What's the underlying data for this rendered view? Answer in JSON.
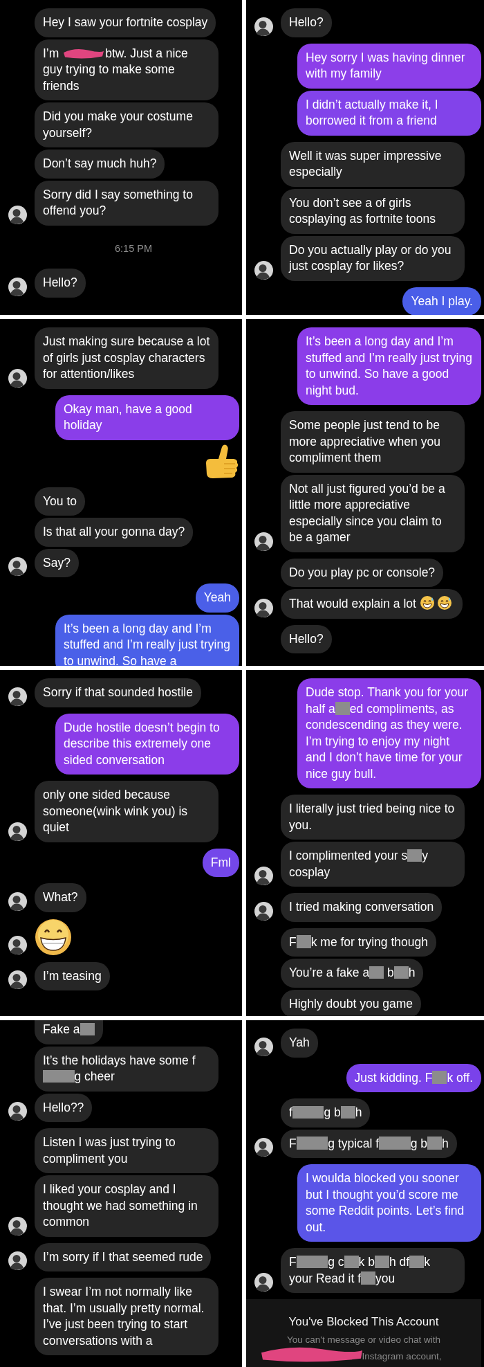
{
  "panels": [
    {
      "items": [
        {
          "kind": "group",
          "outgoing": false,
          "avatar": true,
          "messages": [
            {
              "kind": "text",
              "text": "Hey I saw your fortnite cosplay"
            },
            {
              "kind": "parts",
              "parts": [
                {
                  "kind": "text",
                  "text": "I’m "
                },
                {
                  "kind": "scribble"
                },
                {
                  "kind": "text",
                  "text": "btw. Just a nice"
                },
                {
                  "kind": "block",
                  "text": "guy trying to make some friends"
                }
              ]
            },
            {
              "kind": "text",
              "text": "Did you make your costume yourself?"
            },
            {
              "kind": "text",
              "text": "Don’t say much huh?"
            },
            {
              "kind": "text",
              "text": "Sorry did I say something to offend you?"
            }
          ]
        },
        {
          "kind": "time",
          "text": "6:15 PM"
        },
        {
          "kind": "group",
          "outgoing": false,
          "avatar": true,
          "messages": [
            {
              "kind": "text",
              "text": "Hello?"
            }
          ]
        }
      ]
    },
    {
      "items": [
        {
          "kind": "group",
          "outgoing": false,
          "avatar": true,
          "messages": [
            {
              "kind": "text",
              "text": "Hello?"
            }
          ]
        },
        {
          "kind": "group",
          "outgoing": true,
          "messages": [
            {
              "kind": "text",
              "text": "Hey sorry I was having dinner with my family",
              "color": "#8c3fe9"
            },
            {
              "kind": "text",
              "text": "I didn’t actually make it, I borrowed it from a friend",
              "color": "#8243ea"
            }
          ]
        },
        {
          "kind": "group",
          "outgoing": false,
          "avatar": true,
          "messages": [
            {
              "kind": "text",
              "text": "Well it was super impressive especially"
            },
            {
              "kind": "text",
              "text": "You don’t see a of girls cosplaying as fortnite toons"
            },
            {
              "kind": "text",
              "text": "Do you actually play or do you just cosplay for likes?"
            }
          ]
        },
        {
          "kind": "group",
          "outgoing": true,
          "messages": [
            {
              "kind": "text",
              "text": "Yeah I play.",
              "color": "#4a5ee8"
            }
          ]
        }
      ]
    },
    {
      "items": [
        {
          "kind": "group",
          "outgoing": false,
          "avatar": true,
          "messages": [
            {
              "kind": "text",
              "text": "Just making sure because a lot of girls just cosplay characters for attention/likes"
            }
          ]
        },
        {
          "kind": "group",
          "outgoing": true,
          "messages": [
            {
              "kind": "text",
              "text": "Okay man, have a good holiday",
              "color": "#8a3ee9"
            },
            {
              "kind": "thumbs"
            }
          ]
        },
        {
          "kind": "group",
          "outgoing": false,
          "avatar": true,
          "messages": [
            {
              "kind": "text",
              "text": "You to"
            },
            {
              "kind": "text",
              "text": "Is that all your gonna day?"
            },
            {
              "kind": "text",
              "text": "Say?"
            }
          ]
        },
        {
          "kind": "group",
          "outgoing": true,
          "messages": [
            {
              "kind": "text",
              "text": "Yeah",
              "color": "#4b5fe8"
            },
            {
              "kind": "text",
              "text": "It’s been a long day and I’m stuffed and I’m really just trying to unwind. So have a",
              "color": "#4a60e8"
            }
          ]
        }
      ]
    },
    {
      "items": [
        {
          "kind": "group",
          "outgoing": true,
          "messages": [
            {
              "kind": "text",
              "text": "It’s been a long day and I’m stuffed and I’m really just trying to unwind. So have a good night bud.",
              "color": "#8b3de9"
            }
          ]
        },
        {
          "kind": "group",
          "outgoing": false,
          "avatar": true,
          "messages": [
            {
              "kind": "text",
              "text": "Some people just tend to be more appreciative when you compliment them"
            },
            {
              "kind": "text",
              "text": "Not all just figured you’d be a little more appreciative especially since you claim to be a gamer"
            }
          ]
        },
        {
          "kind": "group",
          "outgoing": false,
          "avatar": true,
          "messages": [
            {
              "kind": "text",
              "text": "Do you play pc or console?"
            },
            {
              "kind": "parts",
              "parts": [
                {
                  "kind": "text",
                  "text": "That would explain a lot "
                },
                {
                  "kind": "emoji"
                },
                {
                  "kind": "emoji"
                }
              ]
            }
          ]
        },
        {
          "kind": "group",
          "outgoing": false,
          "avatar": false,
          "messages": [
            {
              "kind": "text",
              "text": "Hello?"
            }
          ]
        }
      ]
    },
    {
      "items": [
        {
          "kind": "group",
          "outgoing": false,
          "avatar": true,
          "messages": [
            {
              "kind": "text",
              "text": "Sorry if that sounded hostile"
            }
          ]
        },
        {
          "kind": "group",
          "outgoing": true,
          "messages": [
            {
              "kind": "text",
              "text": "Dude hostile doesn’t begin to describe this extremely one sided conversation",
              "color": "#8b3de9"
            }
          ]
        },
        {
          "kind": "group",
          "outgoing": false,
          "avatar": true,
          "messages": [
            {
              "kind": "text",
              "text": "only one sided because someone(wink wink you) is quiet"
            }
          ]
        },
        {
          "kind": "group",
          "outgoing": true,
          "messages": [
            {
              "kind": "text",
              "text": "Fml",
              "color": "#7447ea"
            }
          ]
        },
        {
          "kind": "group",
          "outgoing": false,
          "avatar": true,
          "messages": [
            {
              "kind": "text",
              "text": "What?"
            }
          ]
        },
        {
          "kind": "group",
          "outgoing": false,
          "avatar": true,
          "messages": [
            {
              "kind": "grin"
            }
          ]
        },
        {
          "kind": "group",
          "outgoing": false,
          "avatar": true,
          "messages": [
            {
              "kind": "text",
              "text": "I’m teasing"
            }
          ]
        }
      ]
    },
    {
      "items": [
        {
          "kind": "group",
          "outgoing": true,
          "messages": [
            {
              "kind": "parts",
              "color": "#8b3de9",
              "parts": [
                {
                  "kind": "text",
                  "text": "Dude stop. Thank you for your half a"
                },
                {
                  "kind": "censor"
                },
                {
                  "kind": "text",
                  "text": "ed compliments, as condescending as they were. I’m trying to enjoy my night and I don’t have time for your nice guy bull."
                }
              ]
            }
          ]
        },
        {
          "kind": "group",
          "outgoing": false,
          "avatar": true,
          "messages": [
            {
              "kind": "text",
              "text": "I literally just tried being nice to you."
            },
            {
              "kind": "parts",
              "parts": [
                {
                  "kind": "text",
                  "text": "I complimented your s"
                },
                {
                  "kind": "censor"
                },
                {
                  "kind": "text",
                  "text": "y cosplay"
                }
              ]
            }
          ]
        },
        {
          "kind": "group",
          "outgoing": false,
          "avatar": true,
          "messages": [
            {
              "kind": "text",
              "text": "I tried making conversation"
            }
          ]
        },
        {
          "kind": "group",
          "outgoing": false,
          "avatar": false,
          "messages": [
            {
              "kind": "parts",
              "parts": [
                {
                  "kind": "text",
                  "text": "F"
                },
                {
                  "kind": "censor"
                },
                {
                  "kind": "text",
                  "text": "k me for trying though"
                }
              ]
            },
            {
              "kind": "parts",
              "parts": [
                {
                  "kind": "text",
                  "text": "You’re a fake a"
                },
                {
                  "kind": "censor"
                },
                {
                  "kind": "text",
                  "text": " b"
                },
                {
                  "kind": "censor"
                },
                {
                  "kind": "text",
                  "text": "h"
                }
              ]
            },
            {
              "kind": "text",
              "text": "Highly doubt you game"
            }
          ]
        }
      ]
    },
    {
      "items": [
        {
          "kind": "group",
          "outgoing": false,
          "avatar": true,
          "messages": [
            {
              "kind": "parts",
              "parts": [
                {
                  "kind": "text",
                  "text": "Fake a"
                },
                {
                  "kind": "censor"
                }
              ]
            },
            {
              "kind": "parts",
              "parts": [
                {
                  "kind": "text",
                  "text": "It’s the holidays have some f"
                },
                {
                  "kind": "censor-long"
                },
                {
                  "kind": "text",
                  "text": "g cheer"
                }
              ]
            },
            {
              "kind": "text",
              "text": "Hello??"
            }
          ]
        },
        {
          "kind": "group",
          "outgoing": false,
          "avatar": true,
          "messages": [
            {
              "kind": "text",
              "text": "Listen I was just trying to compliment you"
            },
            {
              "kind": "text",
              "text": "I liked your cosplay and I thought we had something in common"
            }
          ]
        },
        {
          "kind": "group",
          "outgoing": false,
          "avatar": true,
          "messages": [
            {
              "kind": "text",
              "text": "I’m sorry if I that seemed rude"
            }
          ]
        },
        {
          "kind": "group",
          "outgoing": false,
          "avatar": false,
          "messages": [
            {
              "kind": "text",
              "text": "I swear I’m not normally like that. I’m usually pretty normal. I’ve just been trying to start conversations with a"
            }
          ]
        }
      ]
    },
    {
      "items": [
        {
          "kind": "group",
          "outgoing": false,
          "avatar": true,
          "messages": [
            {
              "kind": "text",
              "text": "Yah"
            }
          ]
        },
        {
          "kind": "group",
          "outgoing": true,
          "messages": [
            {
              "kind": "parts",
              "color": "#7a42ea",
              "parts": [
                {
                  "kind": "text",
                  "text": "Just kidding. F"
                },
                {
                  "kind": "censor"
                },
                {
                  "kind": "text",
                  "text": "k off."
                }
              ]
            }
          ]
        },
        {
          "kind": "group",
          "outgoing": false,
          "avatar": true,
          "messages": [
            {
              "kind": "parts",
              "parts": [
                {
                  "kind": "text",
                  "text": "f"
                },
                {
                  "kind": "censor-long"
                },
                {
                  "kind": "text",
                  "text": "g b"
                },
                {
                  "kind": "censor"
                },
                {
                  "kind": "text",
                  "text": "h"
                }
              ]
            },
            {
              "kind": "parts",
              "parts": [
                {
                  "kind": "text",
                  "text": "F"
                },
                {
                  "kind": "censor-long"
                },
                {
                  "kind": "text",
                  "text": "g typical f"
                },
                {
                  "kind": "censor-long"
                },
                {
                  "kind": "text",
                  "text": "g b"
                },
                {
                  "kind": "censor"
                },
                {
                  "kind": "text",
                  "text": "h"
                }
              ]
            }
          ]
        },
        {
          "kind": "group",
          "outgoing": true,
          "messages": [
            {
              "kind": "text",
              "text": "I woulda blocked you sooner but I thought you’d score me some Reddit points. Let’s find out.",
              "color": "#5a55e8"
            }
          ]
        },
        {
          "kind": "group",
          "outgoing": false,
          "avatar": true,
          "messages": [
            {
              "kind": "parts",
              "parts": [
                {
                  "kind": "text",
                  "text": "F"
                },
                {
                  "kind": "censor-long"
                },
                {
                  "kind": "text",
                  "text": "g c"
                },
                {
                  "kind": "censor"
                },
                {
                  "kind": "text",
                  "text": "k b"
                },
                {
                  "kind": "censor"
                },
                {
                  "kind": "text",
                  "text": "h df"
                },
                {
                  "kind": "censor"
                },
                {
                  "kind": "text",
                  "text": "k your Read it f"
                },
                {
                  "kind": "censor"
                },
                {
                  "kind": "text",
                  "text": "you"
                }
              ]
            }
          ]
        },
        {
          "kind": "blocked",
          "title": "You've Blocked This Account",
          "lines": [
            "You can't message or video chat with",
            "Instagram account,"
          ]
        }
      ]
    }
  ]
}
